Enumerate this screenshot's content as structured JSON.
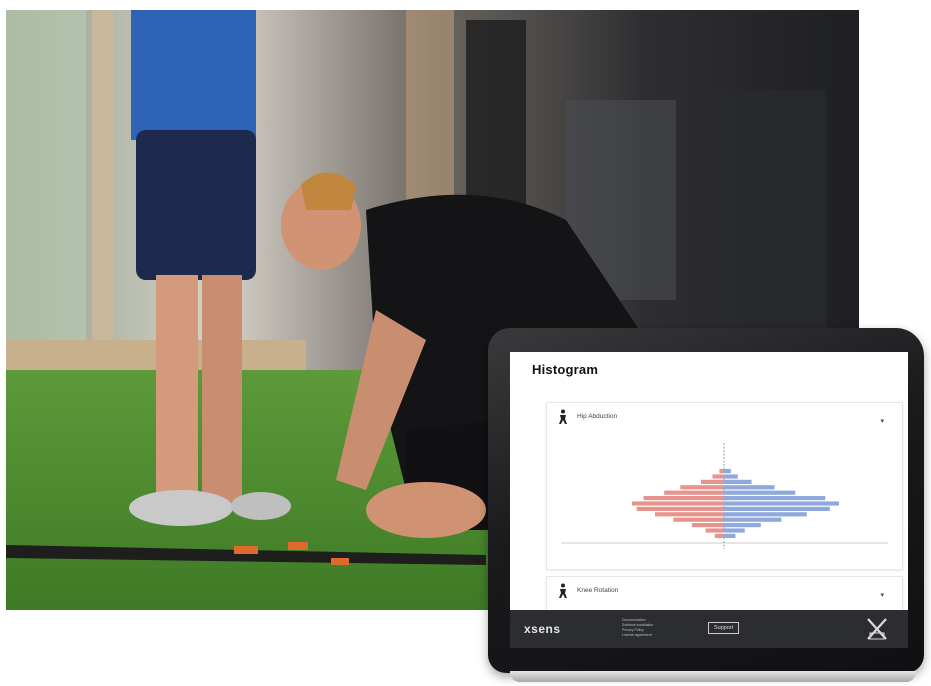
{
  "screen": {
    "title": "Histogram",
    "row1_label": "Hip Abduction",
    "row2_label": "Knee Rotation",
    "expand_icon": "chevron-down-icon"
  },
  "chart_data": {
    "type": "bar",
    "orientation": "horizontal-diverging",
    "colors": {
      "left": "#e8948e",
      "right": "#8fa9dc"
    },
    "left_series": [
      2,
      5,
      10,
      19,
      26,
      35,
      40,
      38,
      30,
      22,
      14,
      8,
      4
    ],
    "right_series": [
      3,
      6,
      12,
      22,
      31,
      44,
      50,
      46,
      36,
      25,
      16,
      9,
      5
    ]
  },
  "footer": {
    "logo": "xsens",
    "support_label": "Support",
    "links": [
      "Documentation",
      "Software installation",
      "Privacy Policy",
      "License agreement"
    ]
  }
}
